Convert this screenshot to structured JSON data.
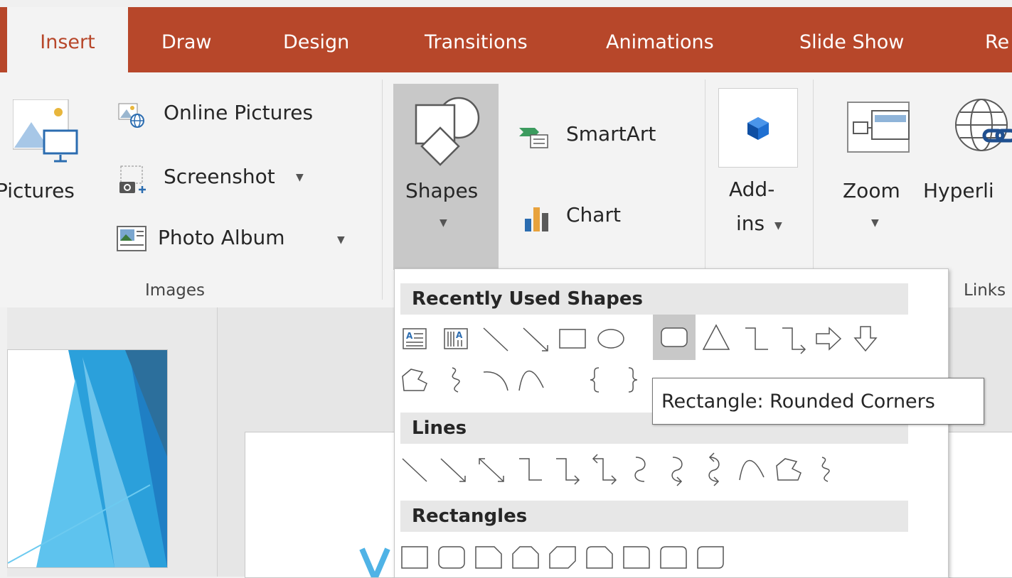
{
  "tabs": [
    {
      "label": "Insert",
      "active": true
    },
    {
      "label": "Draw"
    },
    {
      "label": "Design"
    },
    {
      "label": "Transitions"
    },
    {
      "label": "Animations"
    },
    {
      "label": "Slide Show"
    },
    {
      "label": "Re"
    }
  ],
  "images_group": {
    "pictures_label": "Pictures",
    "online_pictures_label": "Online Pictures",
    "screenshot_label": "Screenshot",
    "photo_album_label": "Photo Album",
    "group_label": "Images"
  },
  "illustrations_group": {
    "shapes_label": "Shapes",
    "smartart_label": "SmartArt",
    "chart_label": "Chart"
  },
  "addins_group": {
    "addins_label_line1": "Add-",
    "addins_label_line2": "ins"
  },
  "links_group": {
    "zoom_label": "Zoom",
    "hyperlink_label": "Hyperli",
    "group_label": "Links"
  },
  "shapes_gallery": {
    "categories": {
      "recent": "Recently Used Shapes",
      "lines": "Lines",
      "rectangles": "Rectangles"
    },
    "selected_shape": "rounded-rectangle"
  },
  "tooltip": {
    "text": "Rectangle: Rounded Corners"
  },
  "colors": {
    "accent": "#b7472a",
    "ribbon_bg": "#f3f3f3",
    "selected_button_bg": "#c8c8c8",
    "selected_shape_bg": "#c8c8c8"
  }
}
